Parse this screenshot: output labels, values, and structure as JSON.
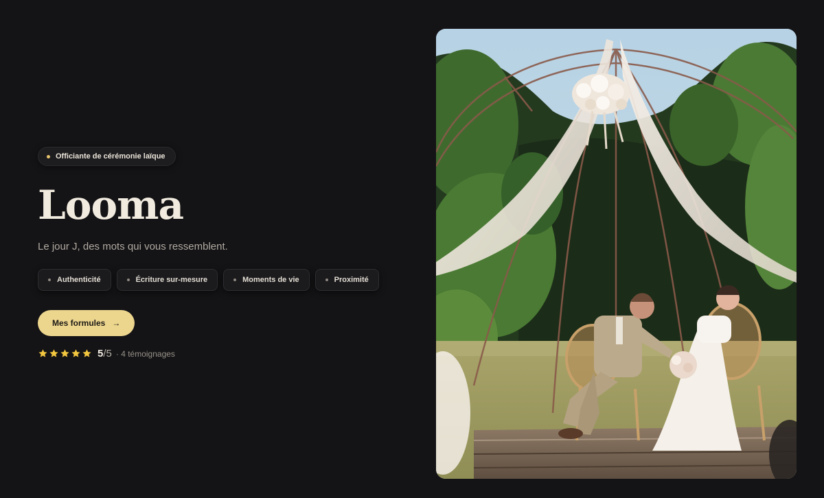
{
  "hero": {
    "eyebrow": "Officiante de cérémonie laïque",
    "title": "Looma",
    "subtitle": "Le jour J, des mots qui vous ressemblent.",
    "tags": [
      "Authenticité",
      "Écriture sur-mesure",
      "Moments de vie",
      "Proximité"
    ],
    "cta_label": "Mes formules",
    "cta_arrow": "→"
  },
  "rating": {
    "stars": 5,
    "score": "5",
    "score_max": "/5",
    "reviews": "· 4 témoignages"
  },
  "photo": {
    "subject": "wedding-ceremony-photo"
  },
  "colors": {
    "background": "#141315",
    "accent": "#ecd58d",
    "star": "#f2c63f",
    "text": "#ece6da"
  }
}
